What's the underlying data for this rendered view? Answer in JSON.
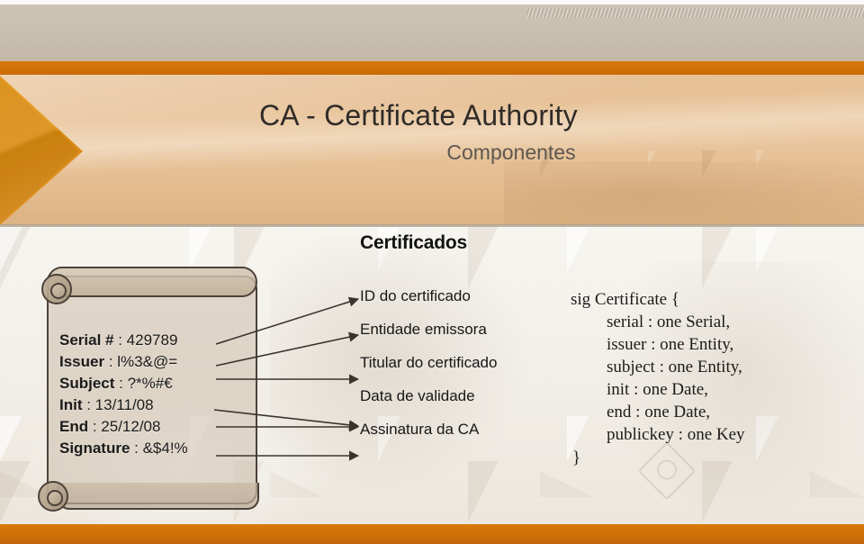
{
  "slide": {
    "title": "CA - Certificate Authority",
    "subtitle": "Componentes",
    "section_heading": "Certificados"
  },
  "colors": {
    "accent_orange": "#cf7006",
    "header_peach": "#e6c095",
    "band_taupe": "#c9bfaf",
    "body_pale": "#f3f0ea",
    "text_dark": "#1b1b1b",
    "outline": "#4c423a"
  },
  "certificate_scroll": {
    "name": "certificate-sample",
    "fields": [
      {
        "key": "Serial #",
        "sep": " : ",
        "value": "429789"
      },
      {
        "key": "Issuer",
        "sep": " : ",
        "value": "l%3&@="
      },
      {
        "key": "Subject",
        "sep": " : ",
        "value": "?*%#€"
      },
      {
        "key": "Init",
        "sep": " : ",
        "value": "13/11/08"
      },
      {
        "key": "End",
        "sep": " : ",
        "value": "25/12/08"
      },
      {
        "key": "Signature",
        "sep": " : ",
        "value": "&$4!%"
      }
    ]
  },
  "components_list": [
    "ID do certificado",
    "Entidade emissora",
    "Titular do certificado",
    "Data de validade",
    "Assinatura da CA"
  ],
  "code_block": {
    "name": "alloy-signature",
    "open_line": "sig Certificate {",
    "body_lines": [
      "serial : one Serial,",
      "issuer : one Entity,",
      "subject : one Entity,",
      "init : one Date,",
      "end : one Date,",
      "publickey : one Key"
    ],
    "close_line": "}"
  },
  "decorations": {
    "chevron": "chevron-right-icon",
    "hatch": "diagonal-hatch-pattern",
    "watermark": "diamond-watermark-icon"
  }
}
